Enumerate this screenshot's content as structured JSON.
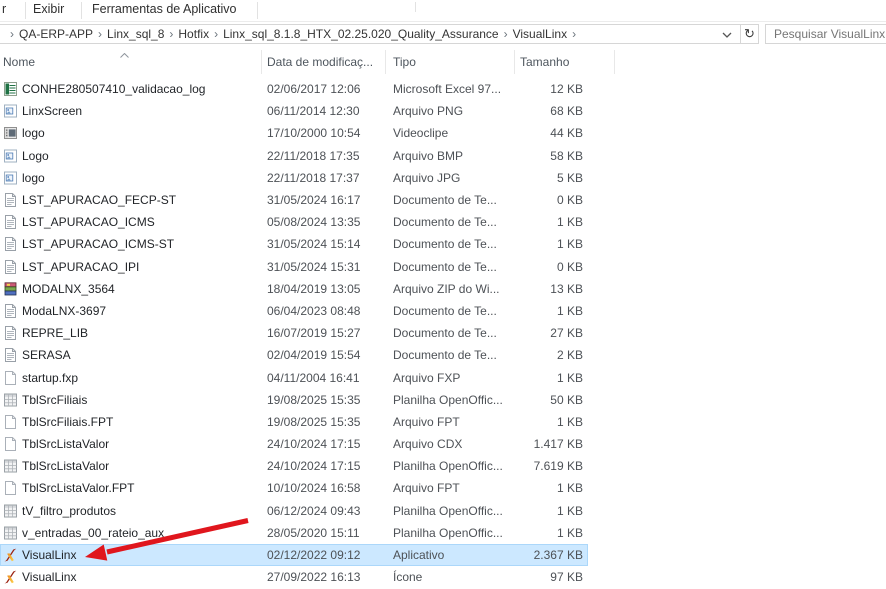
{
  "window": {
    "menu": {
      "fragment": "r",
      "items": [
        {
          "label": "Exibir"
        },
        {
          "label": "Ferramentas de Aplicativo"
        }
      ]
    },
    "breadcrumb": {
      "separator": "›",
      "items": [
        "QA-ERP-APP",
        "Linx_sql_8",
        "Hotfix",
        "Linx_sql_8.1.8_HTX_02.25.020_Quality_Assurance",
        "VisualLinx"
      ]
    },
    "address_controls": {
      "dropdown_icon": "chevron-down-icon",
      "refresh_icon": "refresh-icon",
      "refresh_glyph": "↻"
    },
    "search": {
      "placeholder": "Pesquisar VisualLinx",
      "value": ""
    }
  },
  "list": {
    "columns": [
      "Nome",
      "Data de modificaç...",
      "Tipo",
      "Tamanho"
    ],
    "sort": {
      "column": "Nome",
      "direction": "asc"
    },
    "rows": [
      {
        "name": "CONHE280507410_validacao_log",
        "date": "02/06/2017 12:06",
        "type": "Microsoft Excel 97...",
        "size": "12 KB",
        "icon": "excel",
        "selected": false
      },
      {
        "name": "LinxScreen",
        "date": "06/11/2014 12:30",
        "type": "Arquivo PNG",
        "size": "68 KB",
        "icon": "image",
        "selected": false
      },
      {
        "name": "logo",
        "date": "17/10/2000 10:54",
        "type": "Videoclipe",
        "size": "44 KB",
        "icon": "video",
        "selected": false
      },
      {
        "name": "Logo",
        "date": "22/11/2018 17:35",
        "type": "Arquivo BMP",
        "size": "58 KB",
        "icon": "image",
        "selected": false
      },
      {
        "name": "logo",
        "date": "22/11/2018 17:37",
        "type": "Arquivo JPG",
        "size": "5 KB",
        "icon": "image",
        "selected": false
      },
      {
        "name": "LST_APURACAO_FECP-ST",
        "date": "31/05/2024 16:17",
        "type": "Documento de Te...",
        "size": "0 KB",
        "icon": "textdoc",
        "selected": false
      },
      {
        "name": "LST_APURACAO_ICMS",
        "date": "05/08/2024 13:35",
        "type": "Documento de Te...",
        "size": "1 KB",
        "icon": "textdoc",
        "selected": false
      },
      {
        "name": "LST_APURACAO_ICMS-ST",
        "date": "31/05/2024 15:14",
        "type": "Documento de Te...",
        "size": "1 KB",
        "icon": "textdoc",
        "selected": false
      },
      {
        "name": "LST_APURACAO_IPI",
        "date": "31/05/2024 15:31",
        "type": "Documento de Te...",
        "size": "0 KB",
        "icon": "textdoc",
        "selected": false
      },
      {
        "name": "MODALNX_3564",
        "date": "18/04/2019 13:05",
        "type": "Arquivo ZIP do Wi...",
        "size": "13 KB",
        "icon": "winrar",
        "selected": false
      },
      {
        "name": "ModaLNX-3697",
        "date": "06/04/2023 08:48",
        "type": "Documento de Te...",
        "size": "1 KB",
        "icon": "textdoc",
        "selected": false
      },
      {
        "name": "REPRE_LIB",
        "date": "16/07/2019 15:27",
        "type": "Documento de Te...",
        "size": "27 KB",
        "icon": "textdoc",
        "selected": false
      },
      {
        "name": "SERASA",
        "date": "02/04/2019 15:54",
        "type": "Documento de Te...",
        "size": "2 KB",
        "icon": "textdoc",
        "selected": false
      },
      {
        "name": "startup.fxp",
        "date": "04/11/2004 16:41",
        "type": "Arquivo FXP",
        "size": "1 KB",
        "icon": "blank",
        "selected": false
      },
      {
        "name": "TblSrcFiliais",
        "date": "19/08/2025 15:35",
        "type": "Planilha OpenOffic...",
        "size": "50 KB",
        "icon": "calc",
        "selected": false
      },
      {
        "name": "TblSrcFiliais.FPT",
        "date": "19/08/2025 15:35",
        "type": "Arquivo FPT",
        "size": "1 KB",
        "icon": "blank",
        "selected": false
      },
      {
        "name": "TblSrcListaValor",
        "date": "24/10/2024 17:15",
        "type": "Arquivo CDX",
        "size": "1.417 KB",
        "icon": "blank",
        "selected": false
      },
      {
        "name": "TblSrcListaValor",
        "date": "24/10/2024 17:15",
        "type": "Planilha OpenOffic...",
        "size": "7.619 KB",
        "icon": "calc",
        "selected": false
      },
      {
        "name": "TblSrcListaValor.FPT",
        "date": "10/10/2024 16:58",
        "type": "Arquivo FPT",
        "size": "1 KB",
        "icon": "blank",
        "selected": false
      },
      {
        "name": "tV_filtro_produtos",
        "date": "06/12/2024 09:43",
        "type": "Planilha OpenOffic...",
        "size": "1 KB",
        "icon": "calc",
        "selected": false
      },
      {
        "name": "v_entradas_00_rateio_aux",
        "date": "28/05/2020 15:11",
        "type": "Planilha OpenOffic...",
        "size": "1 KB",
        "icon": "calc",
        "selected": false
      },
      {
        "name": "VisualLinx",
        "date": "02/12/2022 09:12",
        "type": "Aplicativo",
        "size": "2.367 KB",
        "icon": "linx",
        "selected": true
      },
      {
        "name": "VisualLinx",
        "date": "27/09/2022 16:13",
        "type": "Ícone",
        "size": "97 KB",
        "icon": "linx",
        "selected": false
      }
    ]
  },
  "colors": {
    "selection_bg": "#cce8ff",
    "annotation_arrow": "#e0161d"
  }
}
